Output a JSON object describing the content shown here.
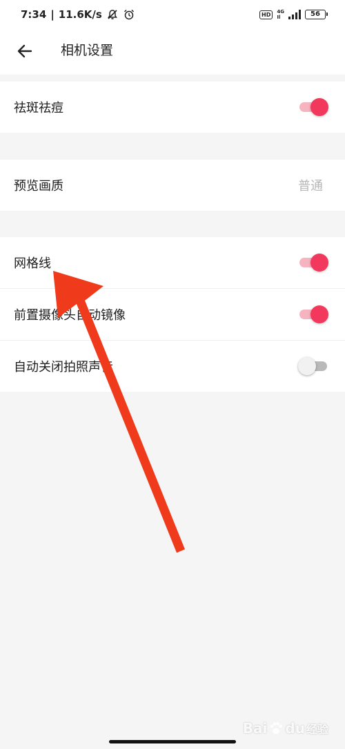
{
  "status_bar": {
    "time": "7:34",
    "separator": "|",
    "network_speed": "11.6K/s",
    "hd_label": "HD",
    "network_type_top": "4G",
    "network_type_bottom": "Il",
    "battery_level": "56"
  },
  "header": {
    "title": "相机设置"
  },
  "settings": {
    "group1": [
      {
        "label": "祛斑祛痘",
        "toggle": "on"
      }
    ],
    "group2": [
      {
        "label": "预览画质",
        "value": "普通"
      }
    ],
    "group3": [
      {
        "label": "网格线",
        "toggle": "on"
      },
      {
        "label": "前置摄像头自动镜像",
        "toggle": "on"
      },
      {
        "label": "自动关闭拍照声音",
        "toggle": "off"
      }
    ]
  },
  "colors": {
    "accent": "#f2385c",
    "accent_track": "#f6b3c0",
    "annotation_arrow": "#f03a1c",
    "background": "#f5f5f5"
  },
  "watermark": {
    "brand": "Bai",
    "brand_end": "du",
    "suffix": "经验"
  }
}
